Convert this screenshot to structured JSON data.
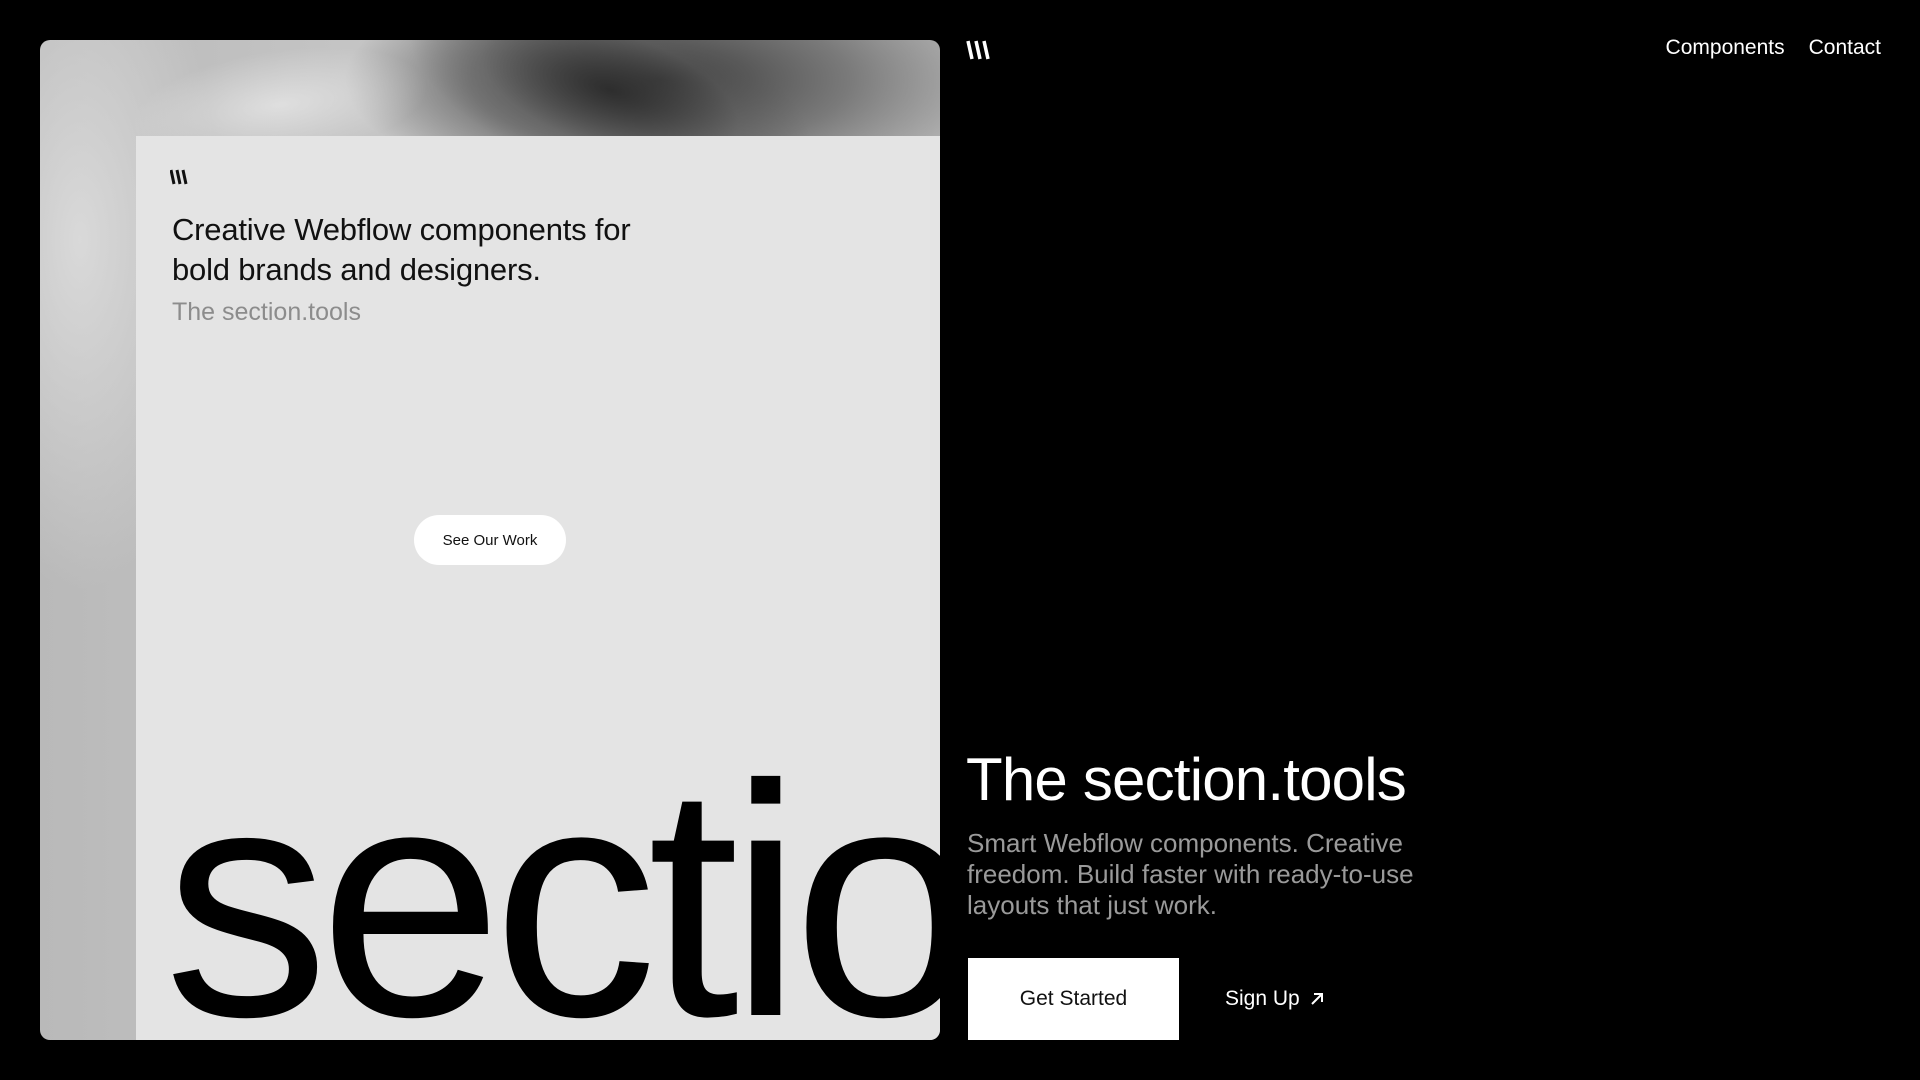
{
  "brand": {
    "logo_icon": "slashes-logo-icon"
  },
  "nav": {
    "items": [
      {
        "label": "Components"
      },
      {
        "label": "Contact"
      }
    ]
  },
  "preview": {
    "headline": "Creative Webflow components for bold brands and designers.",
    "subtitle": "The section.tools",
    "button_label": "See Our Work",
    "big_word": "sectio"
  },
  "hero": {
    "title": "The section.tools",
    "description": "Smart Webflow components. Creative freedom. Build faster with ready-to-use layouts that just work.",
    "primary_button": "Get Started",
    "secondary_link": "Sign Up",
    "secondary_icon": "arrow-up-right-icon"
  },
  "colors": {
    "background": "#000000",
    "card": "#e4e4e4",
    "muted_text": "#9a9a9a",
    "button_bg": "#ffffff"
  }
}
